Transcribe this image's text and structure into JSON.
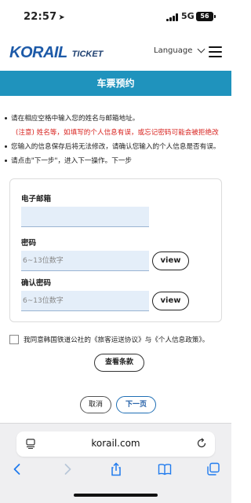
{
  "status_bar": {
    "time": "22:57",
    "network": "5G",
    "battery": "56"
  },
  "header": {
    "logo_main": "KORAIL",
    "logo_sub": "TICKET",
    "language_label": "Language"
  },
  "page_title": "车票预约",
  "notices": [
    "请在相应空格中输入您的姓名与邮箱地址。",
    "(注意) 姓名等，如填写的个人信息有误，或忘记密码可能会被拒绝改",
    "您输入的信息保存后将无法修改，请确认您输入的个人信息是否有误。",
    "请点击\"下一步\"，进入下一操作。下一步"
  ],
  "form": {
    "email_label": "电子邮箱",
    "email_value": "",
    "password_label": "密码",
    "password_placeholder": "6~13位数字",
    "confirm_label": "确认密码",
    "confirm_placeholder": "6~13位数字",
    "view_label": "view"
  },
  "agreement": {
    "text": "我同意韩国铁道公社的《旅客运送协议》与《个人信息政策》。",
    "terms_button": "查看条款"
  },
  "actions": {
    "cancel": "取消",
    "next": "下一页"
  },
  "browser": {
    "url": "korail.com"
  },
  "colors": {
    "accent": "#1f93bd",
    "logo_blue": "#1d5aa8",
    "warning_red": "#d8231f",
    "input_bg": "#e4eef9",
    "ios_blue": "#1f7aee"
  },
  "icons": {
    "location": "location-arrow-icon",
    "signal": "cellular-signal-icon",
    "battery": "battery-icon",
    "language_dropdown": "chevron-down-icon",
    "menu": "hamburger-menu-icon",
    "tabs": "page-format-icon",
    "reload": "reload-icon",
    "back": "back-arrow-icon",
    "forward": "forward-arrow-icon",
    "share": "share-icon",
    "bookmarks": "book-icon",
    "tab_switcher": "tabs-icon"
  }
}
